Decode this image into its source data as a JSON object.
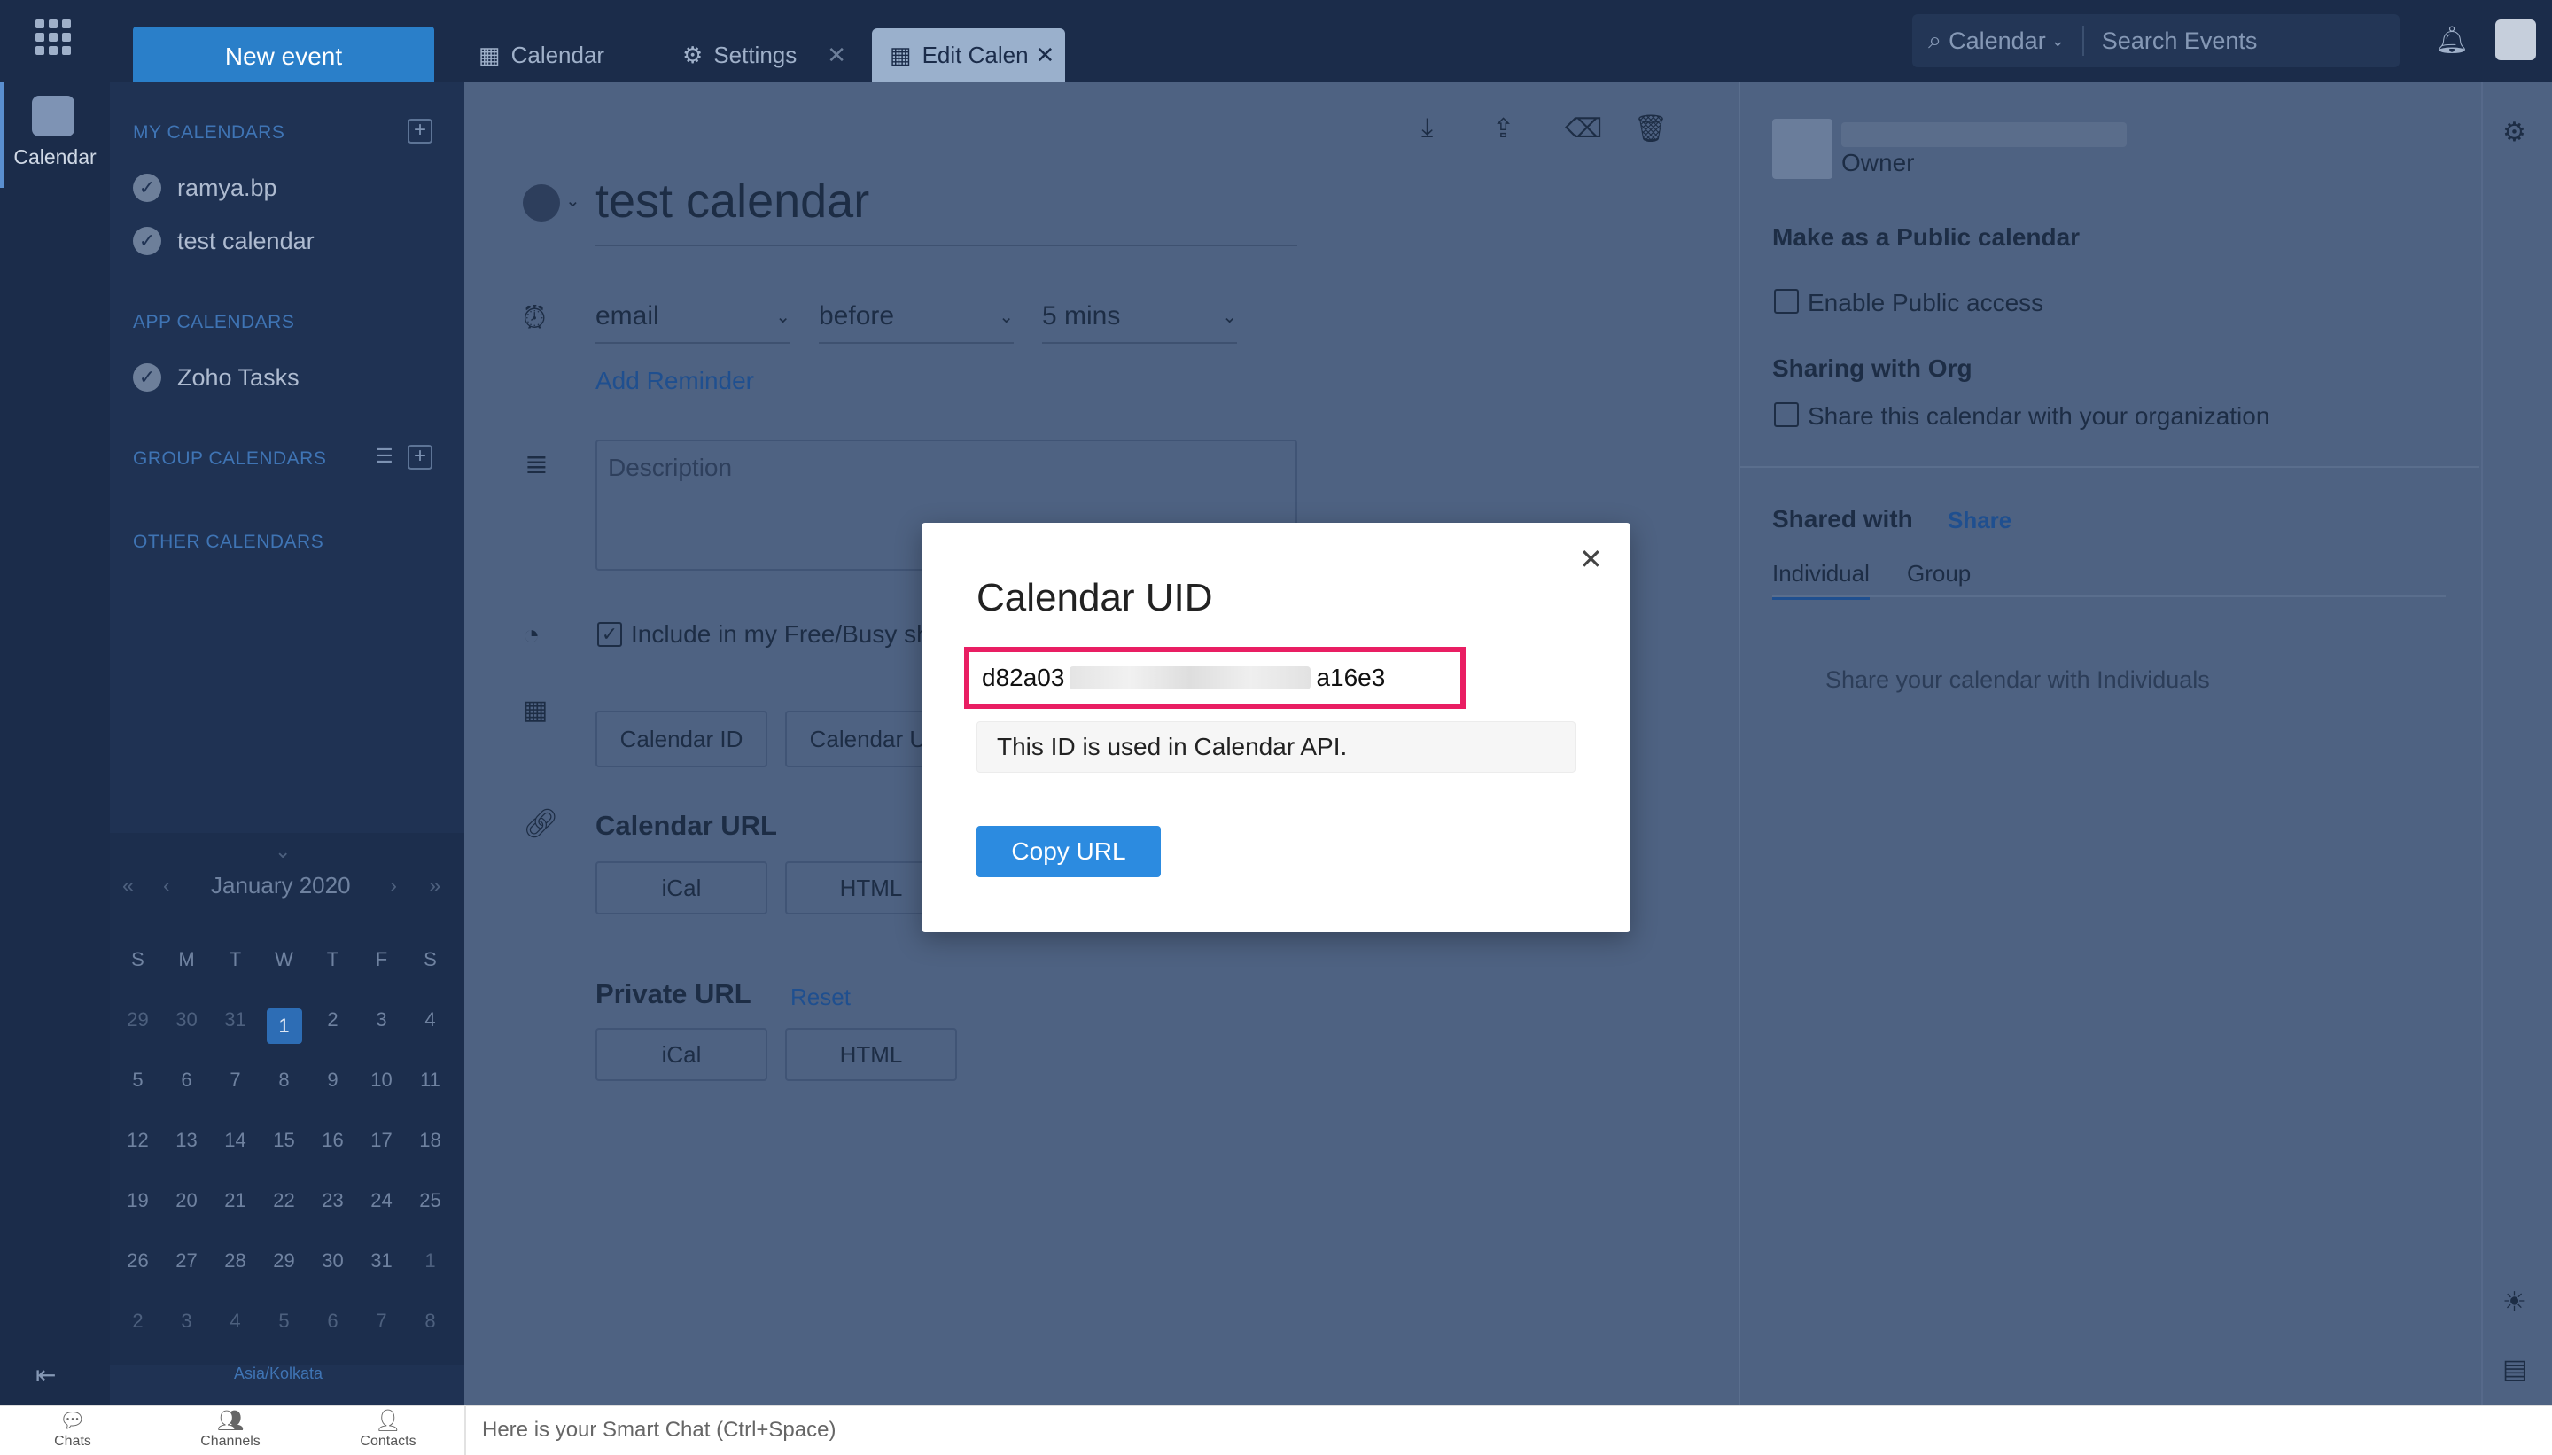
{
  "topbar": {
    "new_event": "New event",
    "tabs": [
      {
        "label": "Calendar"
      },
      {
        "label": "Settings"
      },
      {
        "label": "Edit Calen"
      }
    ],
    "search_scope": "Calendar",
    "search_placeholder": "Search Events"
  },
  "rail": {
    "calendar_label": "Calendar"
  },
  "sidebar": {
    "my_calendars_title": "MY CALENDARS",
    "my_calendars": [
      {
        "label": "ramya.bp"
      },
      {
        "label": "test calendar"
      }
    ],
    "app_calendars_title": "APP CALENDARS",
    "app_calendars": [
      {
        "label": "Zoho Tasks"
      }
    ],
    "group_calendars_title": "GROUP CALENDARS",
    "other_calendars_title": "OTHER CALENDARS"
  },
  "mini_calendar": {
    "month_year": "January  2020",
    "weekdays": [
      "S",
      "M",
      "T",
      "W",
      "T",
      "F",
      "S"
    ],
    "weeks": [
      [
        "29",
        "30",
        "31",
        "1",
        "2",
        "3",
        "4"
      ],
      [
        "5",
        "6",
        "7",
        "8",
        "9",
        "10",
        "11"
      ],
      [
        "12",
        "13",
        "14",
        "15",
        "16",
        "17",
        "18"
      ],
      [
        "19",
        "20",
        "21",
        "22",
        "23",
        "24",
        "25"
      ],
      [
        "26",
        "27",
        "28",
        "29",
        "30",
        "31",
        "1"
      ],
      [
        "2",
        "3",
        "4",
        "5",
        "6",
        "7",
        "8"
      ]
    ],
    "timezone": "Asia/Kolkata"
  },
  "editor": {
    "calendar_name": "test calendar",
    "reminder_type": "email",
    "reminder_relation": "before",
    "reminder_time": "5 mins",
    "add_reminder": "Add Reminder",
    "description_placeholder": "Description",
    "free_busy_label": "Include in my Free/Busy sh",
    "calendar_id_btn": "Calendar ID",
    "calendar_uid_btn": "Calendar UI",
    "calendar_url_title": "Calendar URL",
    "ical": "iCal",
    "html": "HTML",
    "private_url_title": "Private URL",
    "reset": "Reset"
  },
  "right_pane": {
    "owner": "Owner",
    "public_title": "Make as a Public calendar",
    "enable_public": "Enable Public access",
    "sharing_org_title": "Sharing with Org",
    "share_org": "Share this calendar with your organization",
    "shared_with": "Shared with",
    "share": "Share",
    "tab_individual": "Individual",
    "tab_group": "Group",
    "empty_msg": "Share your calendar with Individuals"
  },
  "modal": {
    "title": "Calendar UID",
    "uid_prefix": "d82a03",
    "uid_suffix": "a16e3",
    "info": "This ID is used in Calendar API.",
    "copy_url": "Copy URL"
  },
  "bottombar": {
    "chats": "Chats",
    "channels": "Channels",
    "contacts": "Contacts",
    "smart_chat": "Here is your Smart Chat (Ctrl+Space)"
  }
}
